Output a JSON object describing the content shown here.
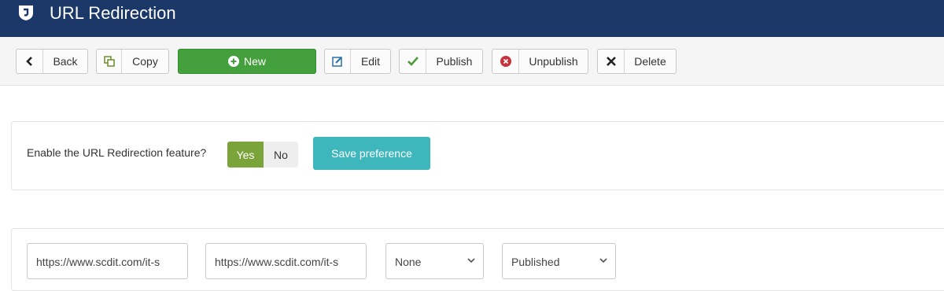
{
  "header": {
    "title": "URL Redirection",
    "logo_icon": "joomla-logo-icon"
  },
  "toolbar": {
    "back": "Back",
    "copy": "Copy",
    "new": "New",
    "edit": "Edit",
    "publish": "Publish",
    "unpublish": "Unpublish",
    "delete": "Delete"
  },
  "preference": {
    "question": "Enable the URL Redirection feature?",
    "yes": "Yes",
    "no": "No",
    "selected": "Yes",
    "save": "Save preference"
  },
  "filters": {
    "old_url": "https://www.scdit.com/it-s",
    "new_url": "https://www.scdit.com/it-s",
    "redirect_type": "None",
    "status": "Published"
  },
  "colors": {
    "header_bg": "#1b3869",
    "new_button": "#44a03c",
    "yes_active": "#7aa33a",
    "save_button": "#3eb7bc",
    "unpublish_icon": "#c8323c"
  }
}
